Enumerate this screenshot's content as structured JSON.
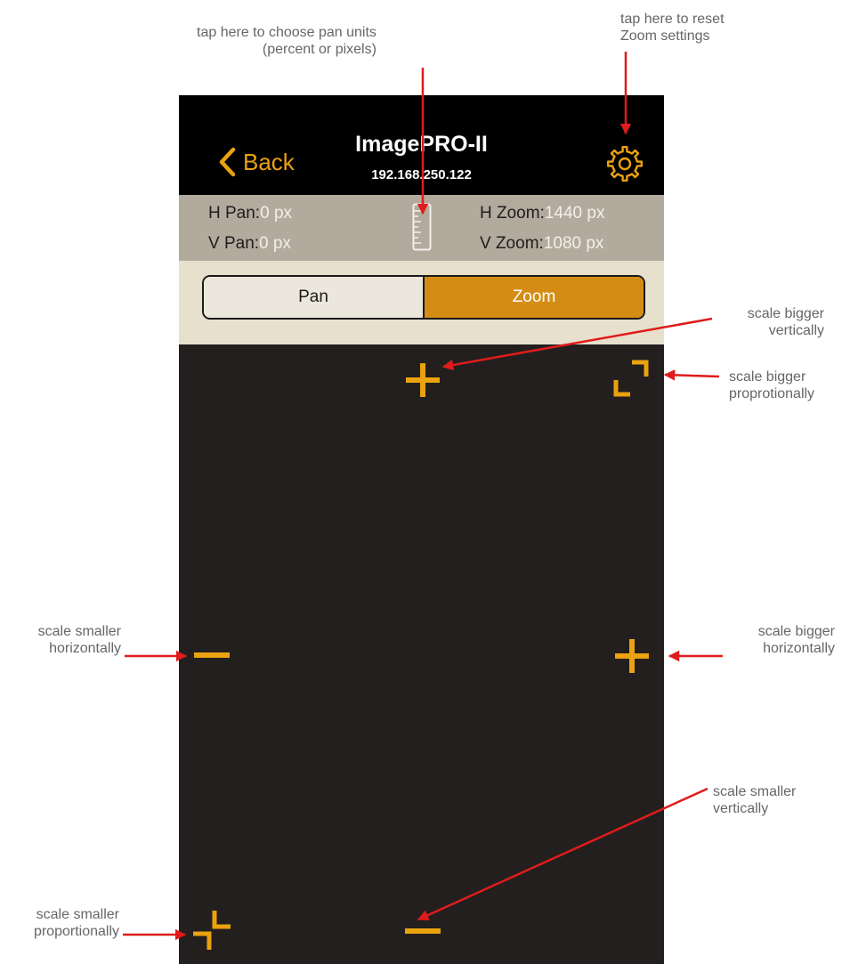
{
  "annotations": {
    "pan_units": [
      "tap here to choose pan units",
      "(percent or pixels)"
    ],
    "reset_zoom": [
      "tap here to reset",
      "Zoom settings"
    ],
    "bigger_vertically": [
      "scale bigger",
      "vertically"
    ],
    "bigger_proportionally": [
      "scale bigger",
      "proprotionally"
    ],
    "smaller_horizontally": [
      "scale smaller",
      "horizontally"
    ],
    "bigger_horizontally": [
      "scale bigger",
      "horizontally"
    ],
    "smaller_vertically": [
      "scale smaller",
      "vertically"
    ],
    "smaller_proportionally": [
      "scale smaller",
      "proportionally"
    ]
  },
  "navbar": {
    "back_label": "Back",
    "title": "ImagePRO-II",
    "subtitle": "192.168.250.122",
    "back_icon": "chevron-left-icon",
    "settings_icon": "gear-icon"
  },
  "status": {
    "h_pan_label": "H Pan:",
    "h_pan_value": "0 px",
    "v_pan_label": "V Pan:",
    "v_pan_value": "0 px",
    "h_zoom_label": "H Zoom:",
    "h_zoom_value": "1440 px",
    "v_zoom_label": "V Zoom:",
    "v_zoom_value": "1080 px",
    "units_icon": "ruler-icon"
  },
  "segmented": {
    "pan_label": "Pan",
    "zoom_label": "Zoom",
    "selected": "Zoom"
  },
  "colors": {
    "accent": "#eaa20f",
    "selected_segment": "#d48d14",
    "arrow": "#e01b1b",
    "canvas": "#231f1e",
    "status_bar": "#b2aa9d"
  }
}
